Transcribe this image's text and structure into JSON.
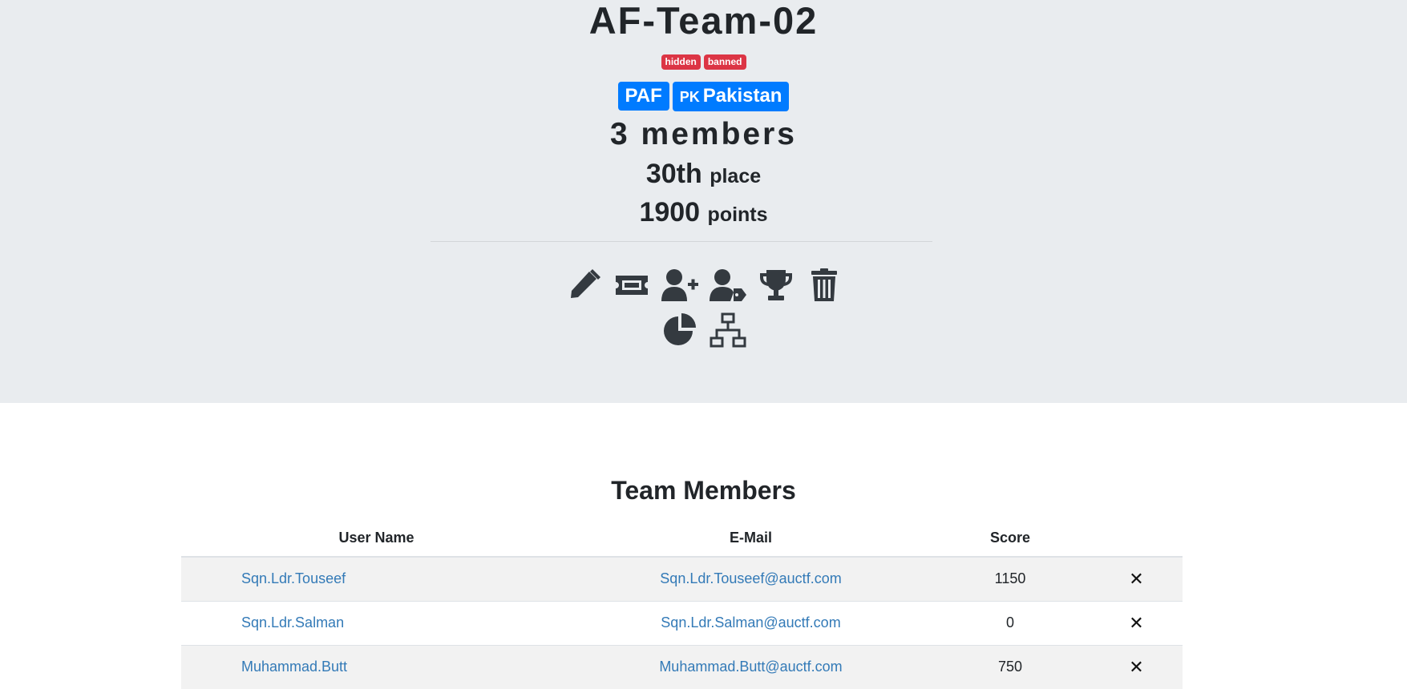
{
  "team": {
    "name": "AF-Team-02",
    "tags": [
      "hidden",
      "banned"
    ],
    "affiliation": "PAF",
    "country_code": "PK",
    "country": "Pakistan",
    "members_text": "3 members",
    "place_value": "30th",
    "place_unit": "place",
    "points_value": "1900",
    "points_unit": "points"
  },
  "actions": {
    "row1": [
      {
        "icon": "pencil-icon"
      },
      {
        "icon": "ticket-icon"
      },
      {
        "icon": "user-plus-icon"
      },
      {
        "icon": "user-tag-icon"
      },
      {
        "icon": "trophy-icon"
      },
      {
        "icon": "trash-icon"
      }
    ],
    "row2": [
      {
        "icon": "chart-pie-icon"
      },
      {
        "icon": "network-icon"
      }
    ]
  },
  "members_section": {
    "title": "Team Members",
    "columns": [
      "User Name",
      "E-Mail",
      "Score"
    ],
    "rows": [
      {
        "user": "Sqn.Ldr.Touseef",
        "email": "Sqn.Ldr.Touseef@auctf.com",
        "score": "1150"
      },
      {
        "user": "Sqn.Ldr.Salman",
        "email": "Sqn.Ldr.Salman@auctf.com",
        "score": "0"
      },
      {
        "user": "Muhammad.Butt",
        "email": "Muhammad.Butt@auctf.com",
        "score": "750"
      }
    ],
    "delete_glyph": "✕"
  },
  "colors": {
    "jumbotron_bg": "#e9ecef",
    "badge_red": "#dc3545",
    "badge_blue": "#007bff",
    "link": "#337ab7",
    "icon": "#343a40"
  }
}
